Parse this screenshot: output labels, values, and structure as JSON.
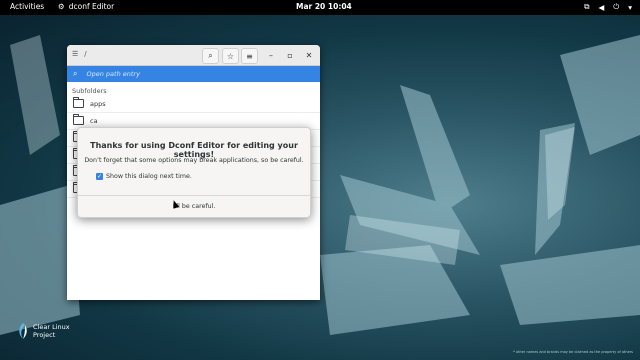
{
  "topbar": {
    "activities": "Activities",
    "app_name": "dconf Editor",
    "clock": "Mar 20  10:04"
  },
  "window": {
    "path": "/",
    "search_placeholder": "Open path entry",
    "section_title": "Subfolders",
    "rows": [
      "apps",
      "ca"
    ]
  },
  "dialog": {
    "title": "Thanks for using Dconf Editor for editing your settings!",
    "message": "Don’t forget that some options may break applications, so be careful.",
    "checkbox_label": "Show this dialog next time.",
    "button_label": "I’ll be careful."
  },
  "desktop": {
    "logo_line1": "Clear Linux",
    "logo_line2": "Project",
    "fine_print": "* other names and brands may be claimed as the property of others"
  },
  "colors": {
    "accent": "#3584e4",
    "topbar": "#000000"
  }
}
